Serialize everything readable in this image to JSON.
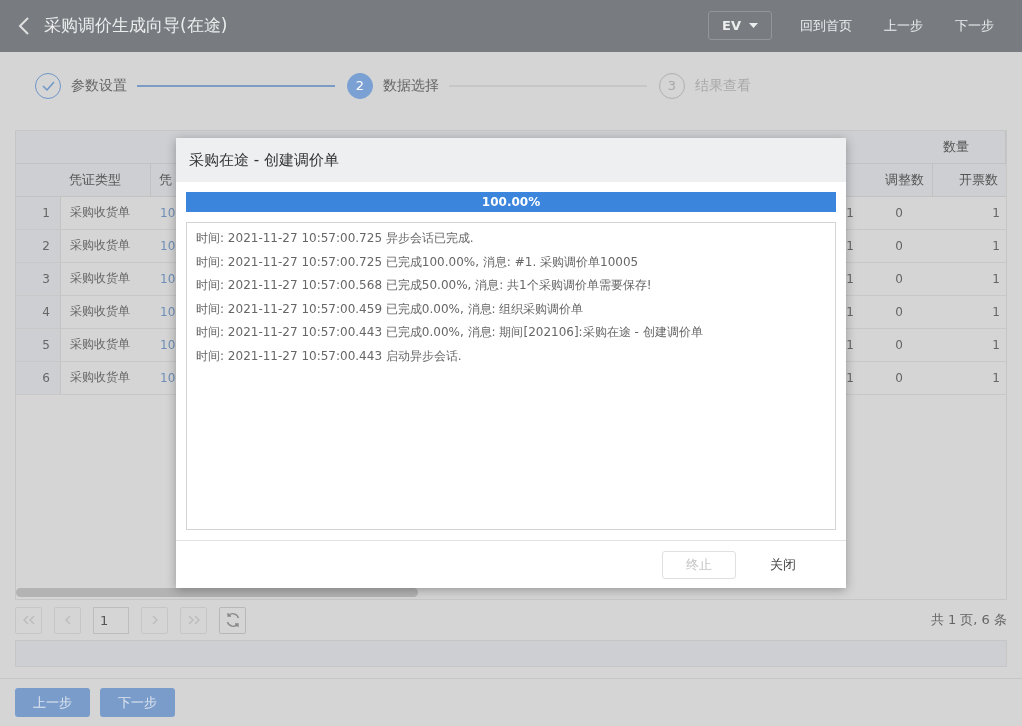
{
  "header": {
    "title": "采购调价生成向导(在途)",
    "menu": "EV",
    "actions": [
      "回到首页",
      "上一步",
      "下一步"
    ]
  },
  "steps": [
    {
      "label": "参数设置",
      "done": true,
      "selected": false
    },
    {
      "number": "2",
      "label": "数据选择",
      "done": false,
      "selected": true
    },
    {
      "number": "3",
      "label": "结果查看",
      "done": false,
      "selected": false
    }
  ],
  "table": {
    "group_header": "数量",
    "columns": {
      "type": "凭证类型",
      "column_2": "凭",
      "adjust": "调整数",
      "invoice": "开票数"
    },
    "rows": [
      {
        "index": "1",
        "type": "采购收货单",
        "column_2": "10",
        "column_3": "1",
        "adjust": "0",
        "invoice": "1"
      },
      {
        "index": "2",
        "type": "采购收货单",
        "column_2": "10",
        "column_3": "1",
        "adjust": "0",
        "invoice": "1"
      },
      {
        "index": "3",
        "type": "采购收货单",
        "column_2": "10",
        "column_3": "1",
        "adjust": "0",
        "invoice": "1"
      },
      {
        "index": "4",
        "type": "采购收货单",
        "column_2": "10",
        "column_3": "1",
        "adjust": "0",
        "invoice": "1"
      },
      {
        "index": "5",
        "type": "采购收货单",
        "column_2": "10",
        "column_3": "1",
        "adjust": "0",
        "invoice": "1"
      },
      {
        "index": "6",
        "type": "采购收货单",
        "column_2": "10",
        "column_3": "1",
        "adjust": "0",
        "invoice": "1"
      }
    ]
  },
  "pagination": {
    "page": "1",
    "summary": "共 1 页, 6 条"
  },
  "footer_buttons": [
    "上一步",
    "下一步"
  ],
  "dialog": {
    "title": "采购在途 - 创建调价单",
    "progress": {
      "level": 1,
      "text": "100.00%"
    },
    "log": [
      "时间: 2021-11-27 10:57:00.725 异步会话已完成.",
      "时间: 2021-11-27 10:57:00.725 已完成100.00%, 消息: #1. 采购调价单10005",
      "时间: 2021-11-27 10:57:00.568 已完成50.00%, 消息: 共1个采购调价单需要保存!",
      "时间: 2021-11-27 10:57:00.459 已完成0.00%, 消息: 组织采购调价单",
      "时间: 2021-11-27 10:57:00.443 已完成0.00%, 消息: 期间[202106]:采购在途 - 创建调价单",
      "时间: 2021-11-27 10:57:00.443 启动异步会话."
    ],
    "buttons": [
      {
        "label": "终止",
        "disabled": true
      },
      {
        "label": "关闭",
        "disabled": false
      }
    ]
  }
}
